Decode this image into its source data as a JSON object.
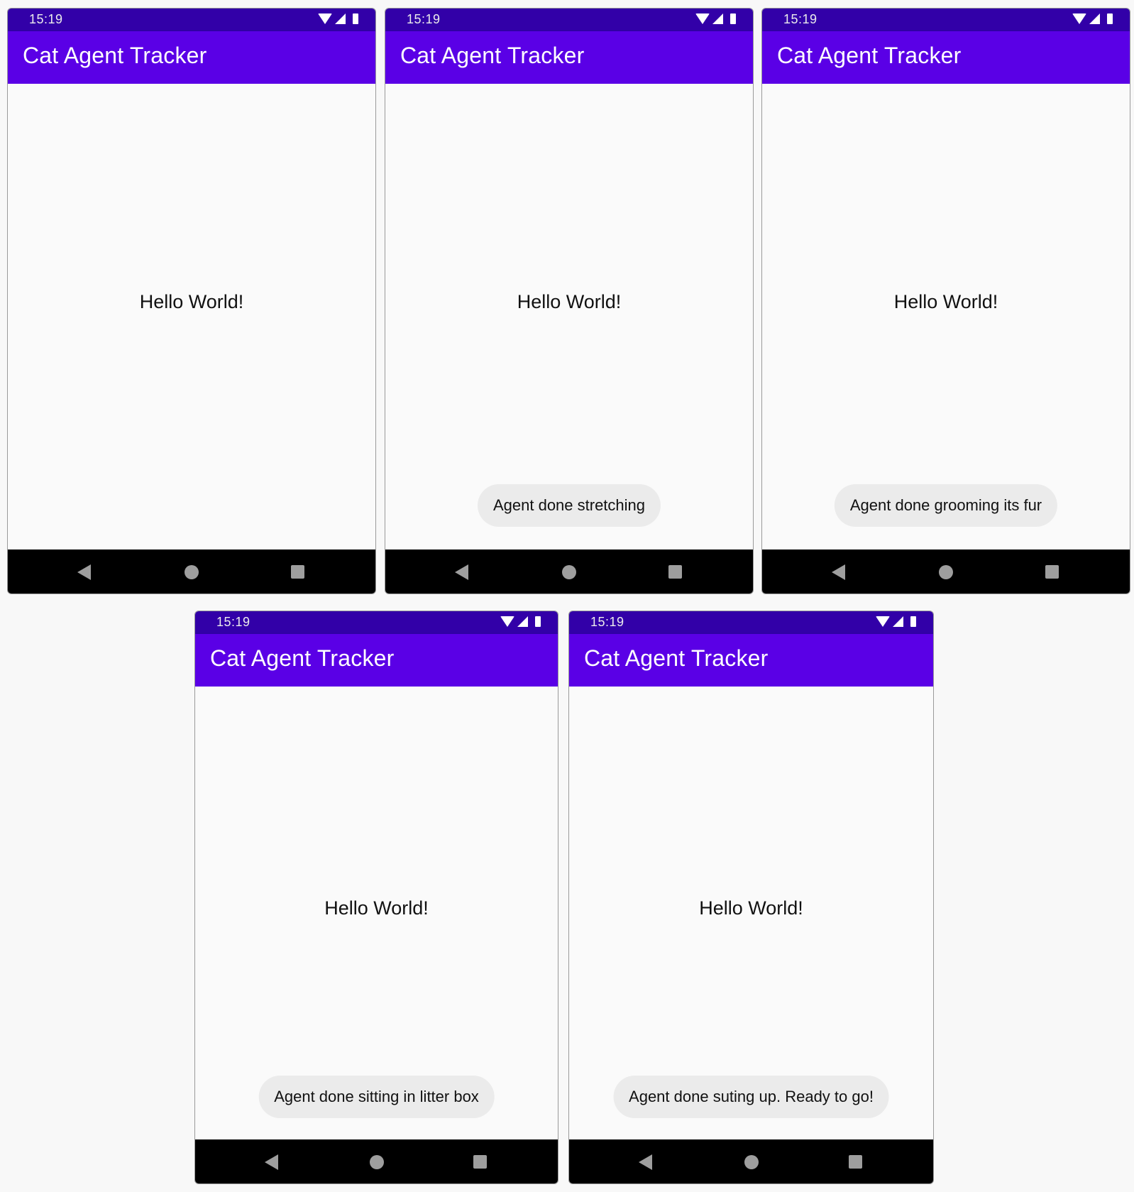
{
  "screens": [
    {
      "status_time": "15:19",
      "title": "Cat Agent Tracker",
      "message": "Hello World!",
      "toast": ""
    },
    {
      "status_time": "15:19",
      "title": "Cat Agent Tracker",
      "message": "Hello World!",
      "toast": "Agent done stretching"
    },
    {
      "status_time": "15:19",
      "title": "Cat Agent Tracker",
      "message": "Hello World!",
      "toast": "Agent done grooming its fur"
    },
    {
      "status_time": "15:19",
      "title": "Cat Agent Tracker",
      "message": "Hello World!",
      "toast": "Agent done sitting in litter box"
    },
    {
      "status_time": "15:19",
      "title": "Cat Agent Tracker",
      "message": "Hello World!",
      "toast": "Agent done suting up. Ready to go!"
    }
  ],
  "icons": {
    "status": [
      "wifi-icon",
      "signal-icon",
      "battery-icon"
    ],
    "nav": [
      "back-icon",
      "home-icon",
      "recents-icon"
    ]
  },
  "colors": {
    "status_bar": "#3200a8",
    "app_bar": "#5a00e6",
    "content_background": "#fafafa",
    "toast_background": "#ebebeb",
    "nav_bar": "#000000"
  }
}
